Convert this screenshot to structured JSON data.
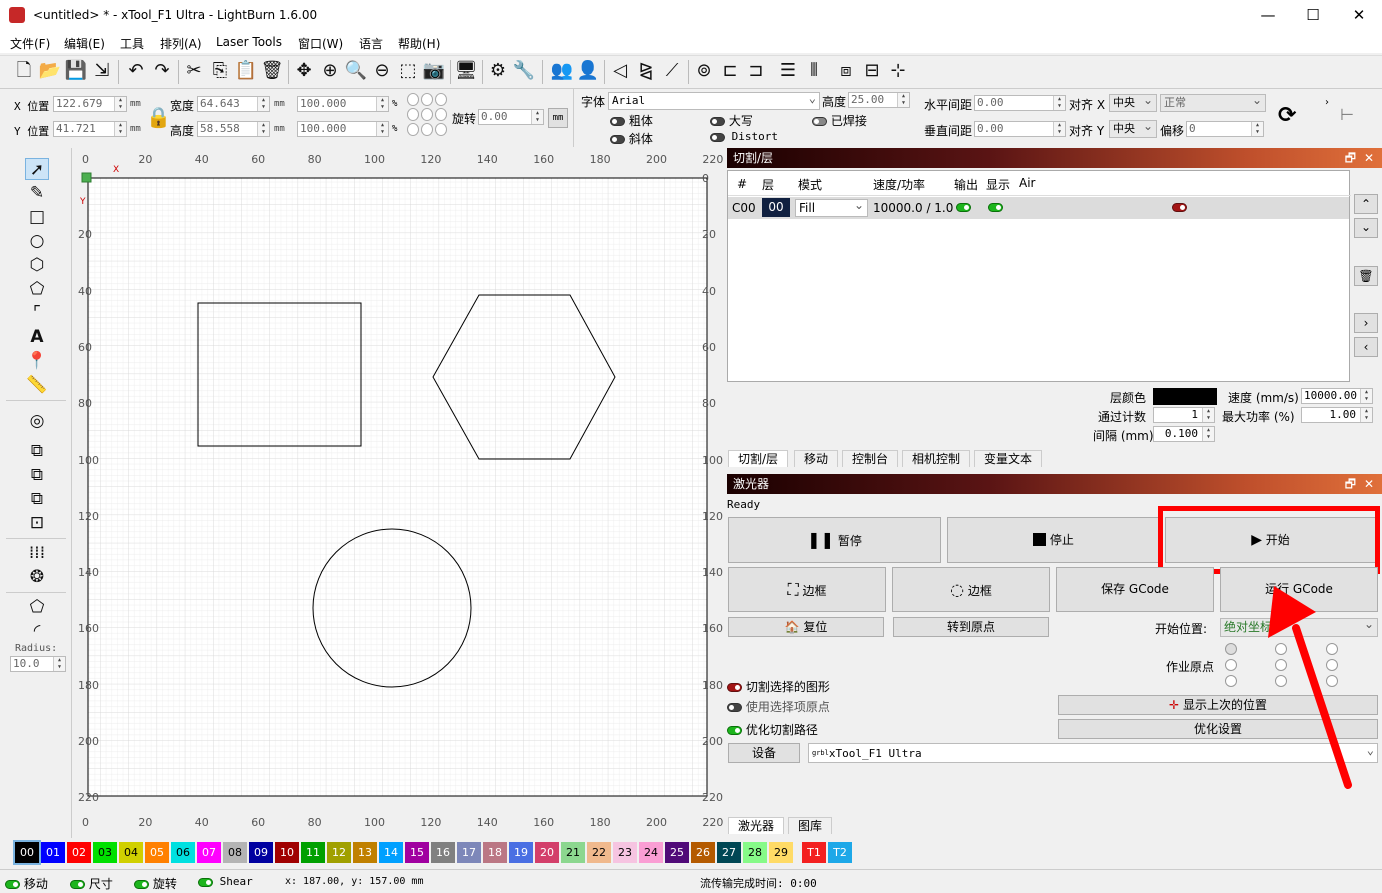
{
  "window": {
    "title": "<untitled> * - xTool_F1 Ultra - LightBurn 1.6.00"
  },
  "menu": [
    "文件(F)",
    "编辑(E)",
    "工具",
    "排列(A)",
    "Laser Tools",
    "窗口(W)",
    "语言",
    "帮助(H)"
  ],
  "props": {
    "x_label": "X 位置",
    "x_value": "122.679",
    "y_label": "Y 位置",
    "y_value": "41.721",
    "unit": "mm",
    "width_label": "宽度",
    "width_value": "64.643",
    "height_label": "高度",
    "height_value": "58.558",
    "scale_x": "100.000",
    "scale_y": "100.000",
    "pct": "%",
    "rotate_label": "旋转",
    "rotate_value": "0.00",
    "mm_btn": "mm",
    "font_label": "字体",
    "font_value": "Arial",
    "text_height_label": "高度",
    "text_height_value": "25.00",
    "bold": "粗体",
    "italic": "斜体",
    "upper": "大写",
    "distort": "Distort",
    "welded": "已焊接",
    "hspace_label": "水平间距",
    "hspace_value": "0.00",
    "vspace_label": "垂直间距",
    "vspace_value": "0.00",
    "align_x_label": "对齐 X",
    "align_x_value": "中央",
    "align_y_label": "对齐 Y",
    "align_y_value": "中央",
    "normal_value": "正常",
    "offset_label": "偏移",
    "offset_value": "0"
  },
  "left_tools": {
    "radius_label": "Radius:",
    "radius_value": "10.0"
  },
  "canvas": {
    "x_ticks": [
      "0",
      "20",
      "40",
      "60",
      "80",
      "100",
      "120",
      "140",
      "160",
      "180",
      "200",
      "220"
    ],
    "y_ticks": [
      "0",
      "20",
      "40",
      "60",
      "80",
      "100",
      "120",
      "140",
      "160",
      "180",
      "200",
      "220"
    ],
    "x_marker": "X",
    "y_marker": "Y"
  },
  "cut_panel": {
    "title": "切割/层",
    "headers": [
      "#",
      "层",
      "模式",
      "速度/功率",
      "输出",
      "显示",
      "Air"
    ],
    "row": {
      "id": "C00",
      "layer": "00",
      "mode": "Fill",
      "speed_power": "10000.0 / 1.0"
    },
    "layer_color_label": "层颜色",
    "passes_label": "通过计数",
    "passes_value": "1",
    "interval_label": "间隔 (mm)",
    "interval_value": "0.100",
    "speed_label": "速度 (mm/s)",
    "speed_value": "10000.00",
    "power_label": "最大功率 (%)",
    "power_value": "1.00",
    "tabs": [
      "切割/层",
      "移动",
      "控制台",
      "相机控制",
      "变量文本"
    ]
  },
  "laser_panel": {
    "title": "激光器",
    "status": "Ready",
    "pause": "暂停",
    "stop": "停止",
    "start": "开始",
    "frame1": "边框",
    "frame2": "边框",
    "save_gcode": "保存 GCode",
    "run_gcode": "运行 GCode",
    "home": "复位",
    "goto_origin": "转到原点",
    "start_from_label": "开始位置:",
    "start_from_value": "绝对坐标",
    "job_origin_label": "作业原点",
    "cut_selected": "切割选择的图形",
    "use_selection_origin": "使用选择项原点",
    "optimize_path": "优化切割路径",
    "show_last_pos": "显示上次的位置",
    "optimize_settings": "优化设置",
    "device_btn": "设备",
    "device_value": "xTool_F1 Ultra",
    "device_prefix": "grbl",
    "tabs": [
      "激光器",
      "图库"
    ]
  },
  "palette": {
    "items": [
      "00",
      "01",
      "02",
      "03",
      "04",
      "05",
      "06",
      "07",
      "08",
      "09",
      "10",
      "11",
      "12",
      "13",
      "14",
      "15",
      "16",
      "17",
      "18",
      "19",
      "20",
      "21",
      "22",
      "23",
      "24",
      "25",
      "26",
      "27",
      "28",
      "29",
      "T1",
      "T2"
    ],
    "colors": [
      "#000000",
      "#0000ff",
      "#ff0000",
      "#00e000",
      "#d0d000",
      "#ff8000",
      "#00e0e0",
      "#ff00ff",
      "#b4b4b4",
      "#0000a0",
      "#a00000",
      "#00a000",
      "#a0a000",
      "#c08000",
      "#00a0ff",
      "#a000a0",
      "#808080",
      "#7d87b9",
      "#bb7784",
      "#4a6fe3",
      "#d33f6a",
      "#8cd78f",
      "#f0b98d",
      "#f6c4e1",
      "#fa9ed4",
      "#500a78",
      "#b45a00",
      "#004754",
      "#86fa88",
      "#ffdb66",
      "#f32020",
      "#1da8e8"
    ]
  },
  "statusbar": {
    "move": "移动",
    "size": "尺寸",
    "rotate": "旋转",
    "shear": "Shear",
    "coords": "x: 187.00, y: 157.00 mm",
    "elapsed": "流传输完成时间: 0:00"
  },
  "accent": {
    "annotation_red": "#ff0000"
  }
}
